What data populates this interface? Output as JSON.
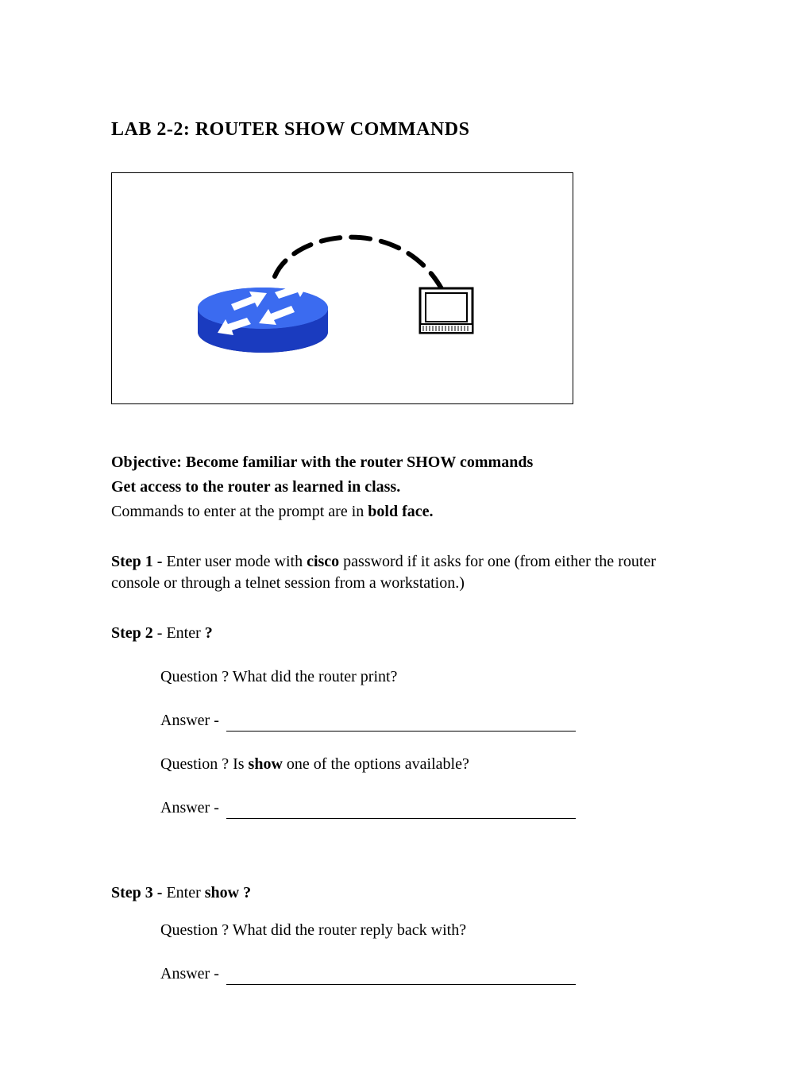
{
  "title": "LAB 2-2: ROUTER SHOW COMMANDS",
  "objective_line1_prefix": "Objective: Become familiar with the router SHOW commands",
  "objective_line2": "Get access to the router as learned in class.",
  "commands_note_prefix": "Commands to enter at the prompt are in ",
  "commands_note_bold": "bold face.",
  "step1_label": "Step 1 - ",
  "step1_text_a": "Enter user mode with ",
  "step1_bold": "cisco",
  "step1_text_b": " password if it asks for one (from either the router console or through a telnet session from a workstation.)",
  "step2_label": "Step 2",
  "step2_mid": " - Enter ",
  "step2_bold": "?",
  "step2_q1": "Question ? What did the router print?",
  "step2_a1": "Answer - ",
  "step2_q2_a": "Question ? Is ",
  "step2_q2_bold": "show",
  "step2_q2_b": " one of the options available?",
  "step2_a2": " Answer - ",
  "step3_label": "Step 3 - ",
  "step3_text": "Enter ",
  "step3_bold": "show ?",
  "step3_q1": " Question ? What did the router reply back with?",
  "step3_a1": "  Answer - "
}
